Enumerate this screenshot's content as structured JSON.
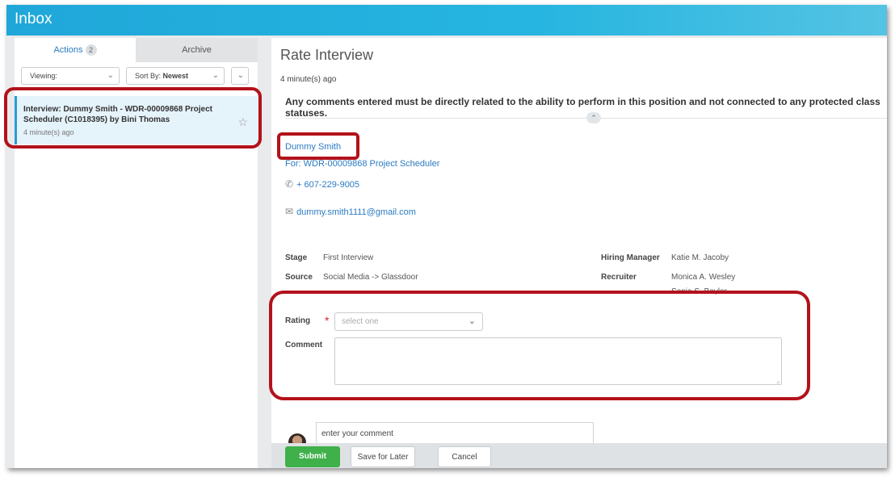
{
  "app": {
    "title": "Inbox"
  },
  "left": {
    "tabs": [
      {
        "label": "Actions",
        "count": "2"
      },
      {
        "label": "Archive"
      }
    ],
    "viewing_label": "Viewing:",
    "sort_prefix": "Sort By:",
    "sort_value": "Newest",
    "item": {
      "title": "Interview: Dummy Smith - WDR-00009868 Project Scheduler (C1018395) by Bini Thomas",
      "time": "4 minute(s) ago"
    }
  },
  "right": {
    "title": "Rate Interview",
    "time": "4 minute(s) ago",
    "notice": "Any comments entered must be directly related to the ability to perform in this position and not connected to any protected class statuses.",
    "candidate": "Dummy Smith",
    "requisition": "For: WDR-00009868 Project Scheduler",
    "phone": "+ 607-229-9005",
    "email": "dummy.smith1111@gmail.com",
    "details": {
      "stage_label": "Stage",
      "stage_value": "First Interview",
      "source_label": "Source",
      "source_value": "Social Media -> Glassdoor",
      "hm_label": "Hiring Manager",
      "hm_value": "Katie M. Jacoby",
      "recruiter_label": "Recruiter",
      "recruiter_value": "Monica A. Wesley",
      "recruiter_value2": "Sonia S. Baylor"
    },
    "form": {
      "rating_label": "Rating",
      "rating_placeholder": "select one",
      "comment_label": "Comment"
    },
    "comment_input": "enter your comment",
    "buttons": {
      "submit": "Submit",
      "later": "Save for Later",
      "cancel": "Cancel"
    }
  },
  "colors": {
    "accent": "#1fa7d9",
    "link": "#2b7bc2",
    "submit": "#3fb04a",
    "highlight": "#b3121b"
  },
  "icons": [
    "chevron-down-icon",
    "star-icon",
    "phone-icon",
    "mail-icon",
    "chevron-up-icon",
    "resize-grip-icon"
  ]
}
